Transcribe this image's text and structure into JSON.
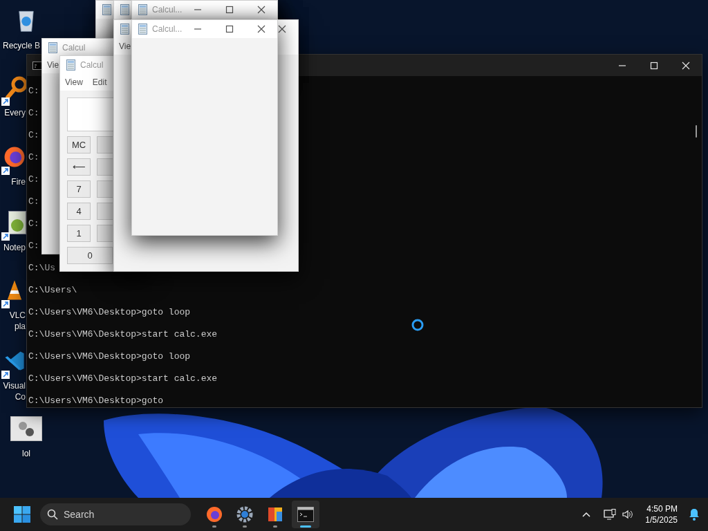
{
  "desktop_icons": [
    {
      "kind": "recycle_bin",
      "label": [
        "Recycle B"
      ],
      "shortcut": false
    },
    {
      "kind": "search_tool",
      "label": [
        "Every"
      ],
      "shortcut": true
    },
    {
      "kind": "browser",
      "label": [
        "Fire"
      ],
      "shortcut": true
    },
    {
      "kind": "notepad",
      "label": [
        "Notep"
      ],
      "shortcut": true
    },
    {
      "kind": "media_player",
      "label": [
        "VLC",
        "pla"
      ],
      "shortcut": true
    },
    {
      "kind": "code_editor",
      "label": [
        "Visual",
        "Co"
      ],
      "shortcut": true
    },
    {
      "kind": "settings_file",
      "label": [
        "lol"
      ],
      "shortcut": false
    }
  ],
  "console": {
    "lines": [
      "C:",
      "C:",
      "C:",
      "C:",
      "C:",
      "C:",
      "C:",
      "C:",
      "C:\\Us",
      "C:\\Users\\",
      "C:\\Users\\VM6\\Desktop>goto loop",
      "C:\\Users\\VM6\\Desktop>start calc.exe",
      "C:\\Users\\VM6\\Desktop>goto loop",
      "C:\\Users\\VM6\\Desktop>start calc.exe",
      "C:\\Users\\VM6\\Desktop>goto"
    ],
    "minimize": true,
    "maximize": true,
    "close": true
  },
  "calculator_windows": [
    {
      "icon": true
    },
    {
      "icon": true
    },
    {
      "icon": true,
      "title": "Calcul...",
      "minimize": true,
      "maximize": true,
      "close": true
    },
    {
      "icon": true,
      "title": "Calcul",
      "menu": [
        "Vie"
      ]
    },
    {
      "icon": true,
      "title": "Calcul",
      "menu": [
        "View",
        "Edit"
      ],
      "buttons": [
        "MC",
        "⟵",
        "7",
        "4",
        "1",
        "0"
      ]
    },
    {
      "icon": true,
      "menu": [
        "Vie"
      ],
      "close": true
    },
    {
      "icon": true,
      "title": "Calcul...",
      "minimize": true,
      "maximize": true,
      "close": true
    }
  ],
  "taskbar": {
    "search": {
      "placeholder": "Search"
    },
    "apps": [
      {
        "kind": "browser",
        "selected": false
      },
      {
        "kind": "settings",
        "selected": false
      },
      {
        "kind": "paint",
        "selected": false
      },
      {
        "kind": "terminal",
        "selected": true
      }
    ],
    "time": "4:50 PM",
    "date": "1/5/2025"
  }
}
